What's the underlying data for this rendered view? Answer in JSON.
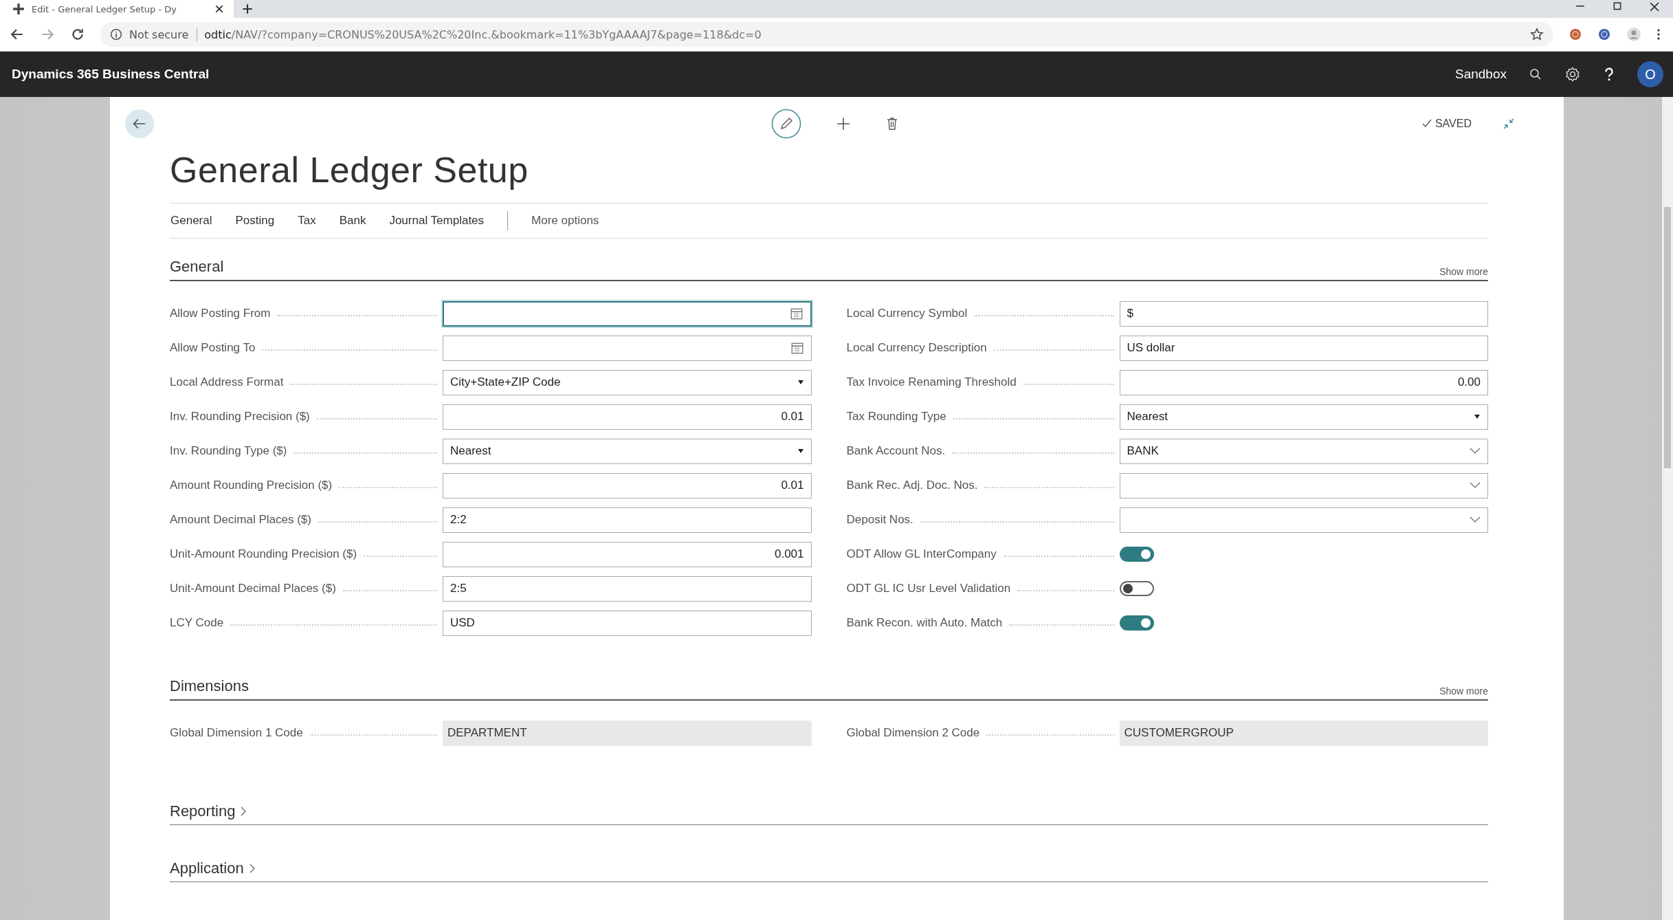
{
  "browser": {
    "tab_title": "Edit - General Ledger Setup - Dy",
    "security": "Not secure",
    "url_host": "odtic",
    "url_path": "/NAV/?company=CRONUS%20USA%2C%20Inc.&bookmark=11%3bYgAAAAJ7&page=118&dc=0"
  },
  "app_bar": {
    "title": "Dynamics 365 Business Central",
    "environment": "Sandbox",
    "avatar": "O"
  },
  "page": {
    "title": "General Ledger Setup",
    "status": "SAVED",
    "nav": [
      {
        "label": "General"
      },
      {
        "label": "Posting"
      },
      {
        "label": "Tax"
      },
      {
        "label": "Bank"
      },
      {
        "label": "Journal Templates"
      }
    ],
    "more": "More options"
  },
  "sections": [
    {
      "title": "General",
      "expanded": true,
      "show_more": "Show more",
      "columns": [
        [
          {
            "label": "Allow Posting From",
            "kind": "date",
            "focused": true
          },
          {
            "label": "Allow Posting To",
            "kind": "date",
            "focused": false
          },
          {
            "label": "Local Address Format",
            "kind": "select",
            "value": "City+State+ZIP Code",
            "focused": false
          },
          {
            "label": "Inv. Rounding Precision ($)",
            "kind": "number",
            "value": "0.01",
            "focused": false
          },
          {
            "label": "Inv. Rounding Type ($)",
            "kind": "select",
            "value": "Nearest",
            "focused": false
          },
          {
            "label": "Amount Rounding Precision ($)",
            "kind": "number",
            "value": "0.01",
            "focused": false
          },
          {
            "label": "Amount Decimal Places ($)",
            "kind": "text",
            "value": "2:2",
            "focused": false
          },
          {
            "label": "Unit-Amount Rounding Precision ($)",
            "kind": "number",
            "value": "0.001",
            "focused": false
          },
          {
            "label": "Unit-Amount Decimal Places ($)",
            "kind": "text",
            "value": "2:5",
            "focused": false
          },
          {
            "label": "LCY Code",
            "kind": "text",
            "value": "USD",
            "focused": false
          }
        ],
        [
          {
            "label": "Local Currency Symbol",
            "kind": "text",
            "value": "$",
            "focused": false
          },
          {
            "label": "Local Currency Description",
            "kind": "text",
            "value": "US dollar",
            "focused": false
          },
          {
            "label": "Tax Invoice Renaming Threshold",
            "kind": "number",
            "value": "0.00",
            "focused": false
          },
          {
            "label": "Tax Rounding Type",
            "kind": "select",
            "value": "Nearest",
            "focused": false
          },
          {
            "label": "Bank Account Nos.",
            "kind": "lookup",
            "value": "BANK",
            "focused": false
          },
          {
            "label": "Bank Rec. Adj. Doc. Nos.",
            "kind": "lookup",
            "focused": false
          },
          {
            "label": "Deposit Nos.",
            "kind": "lookup",
            "focused": false
          },
          {
            "label": "ODT Allow GL InterCompany",
            "kind": "toggle",
            "on": true
          },
          {
            "label": "ODT GL IC Usr Level Validation",
            "kind": "toggle",
            "on": false
          },
          {
            "label": "Bank Recon. with Auto. Match",
            "kind": "toggle",
            "on": true
          }
        ]
      ]
    },
    {
      "title": "Dimensions",
      "expanded": true,
      "show_more": "Show more",
      "columns": [
        [
          {
            "label": "Global Dimension 1 Code",
            "kind": "readonly",
            "value": "DEPARTMENT"
          }
        ],
        [
          {
            "label": "Global Dimension 2 Code",
            "kind": "readonly",
            "value": "CUSTOMERGROUP"
          }
        ]
      ]
    },
    {
      "title": "Reporting",
      "expanded": false
    },
    {
      "title": "Application",
      "expanded": false
    }
  ]
}
